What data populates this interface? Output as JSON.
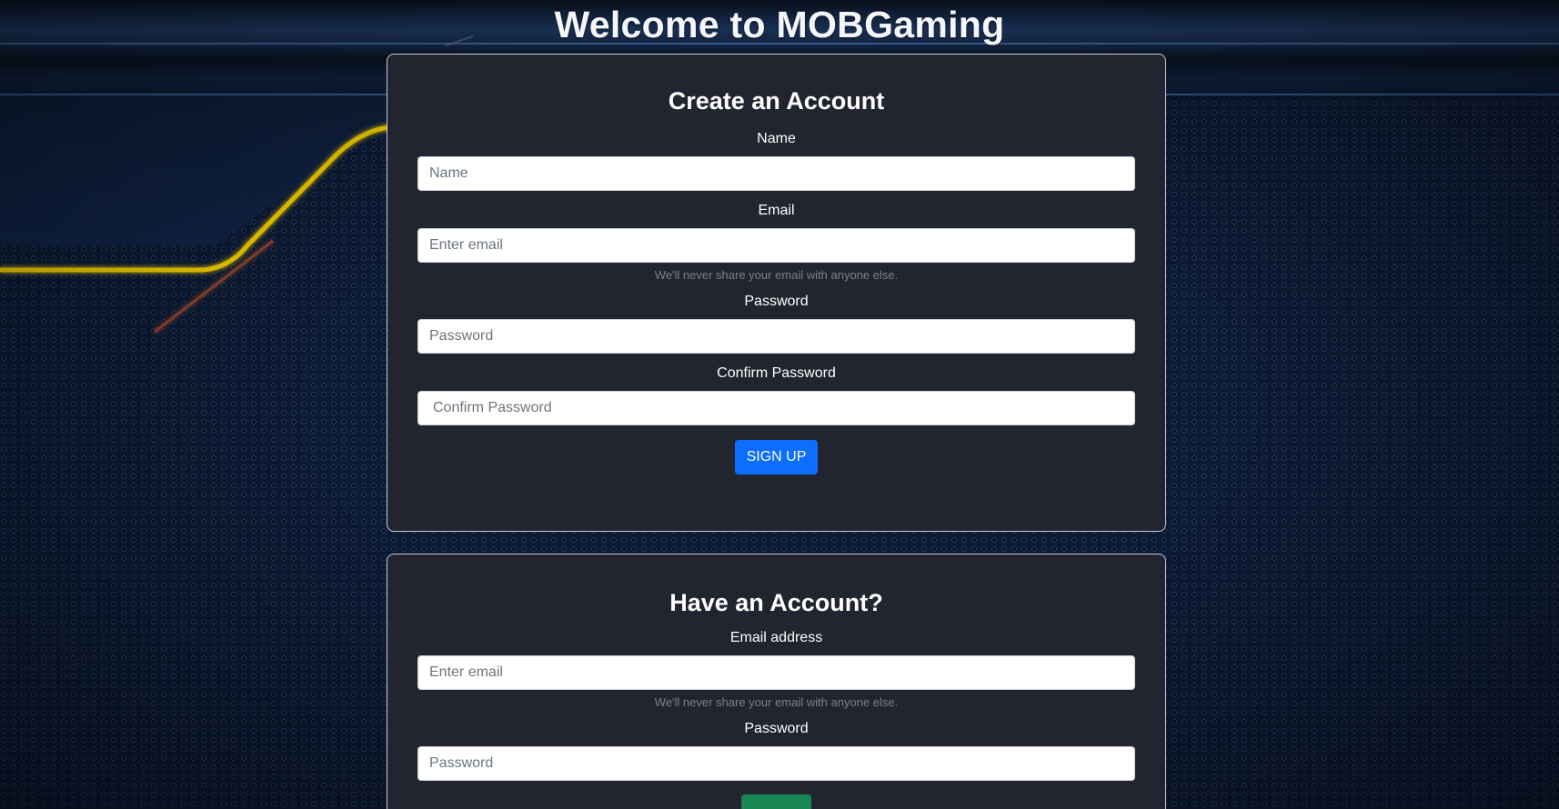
{
  "header": {
    "title": "Welcome to MOBGaming"
  },
  "signup": {
    "title": "Create an Account",
    "name_label": "Name",
    "name_placeholder": "Name",
    "email_label": "Email",
    "email_placeholder": "Enter email",
    "email_help": "We'll never share your email with anyone else.",
    "password_label": "Password",
    "password_placeholder": "Password",
    "confirm_label": "Confirm Password",
    "confirm_placeholder": "Confirm Password",
    "submit_label": "SIGN UP"
  },
  "login": {
    "title": "Have an Account?",
    "email_label": "Email address",
    "email_placeholder": "Enter email",
    "email_help": "We'll never share your email with anyone else.",
    "password_label": "Password",
    "password_placeholder": "Password",
    "submit_label": ""
  },
  "colors": {
    "card_background": "#22252f",
    "primary_button": "#0d6efd",
    "success_button": "#198754",
    "accent_glow": "#f5d000"
  }
}
